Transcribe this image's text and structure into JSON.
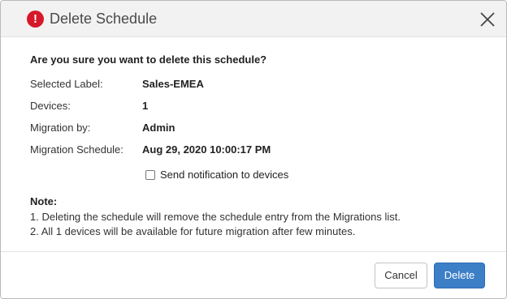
{
  "dialog": {
    "title": "Delete Schedule",
    "alert_icon_glyph": "!",
    "icons": {
      "alert": "exclamation-circle-icon",
      "close": "close-icon"
    },
    "colors": {
      "alert": "#d7182a",
      "primary_button": "#3d7fc6"
    }
  },
  "content": {
    "question": "Are you sure you want to delete this schedule?",
    "details": [
      {
        "label": "Selected Label:",
        "value": "Sales-EMEA"
      },
      {
        "label": "Devices:",
        "value": "1"
      },
      {
        "label": "Migration by:",
        "value": "Admin"
      },
      {
        "label": "Migration Schedule:",
        "value": "Aug 29, 2020 10:00:17 PM"
      }
    ],
    "notify": {
      "label": "Send notification to devices",
      "checked": false
    },
    "note": {
      "title": "Note:",
      "lines": [
        "1. Deleting the schedule will remove the schedule entry from the Migrations list.",
        "2. All 1 devices will be available for future migration after few minutes."
      ]
    }
  },
  "footer": {
    "cancel_label": "Cancel",
    "delete_label": "Delete"
  }
}
